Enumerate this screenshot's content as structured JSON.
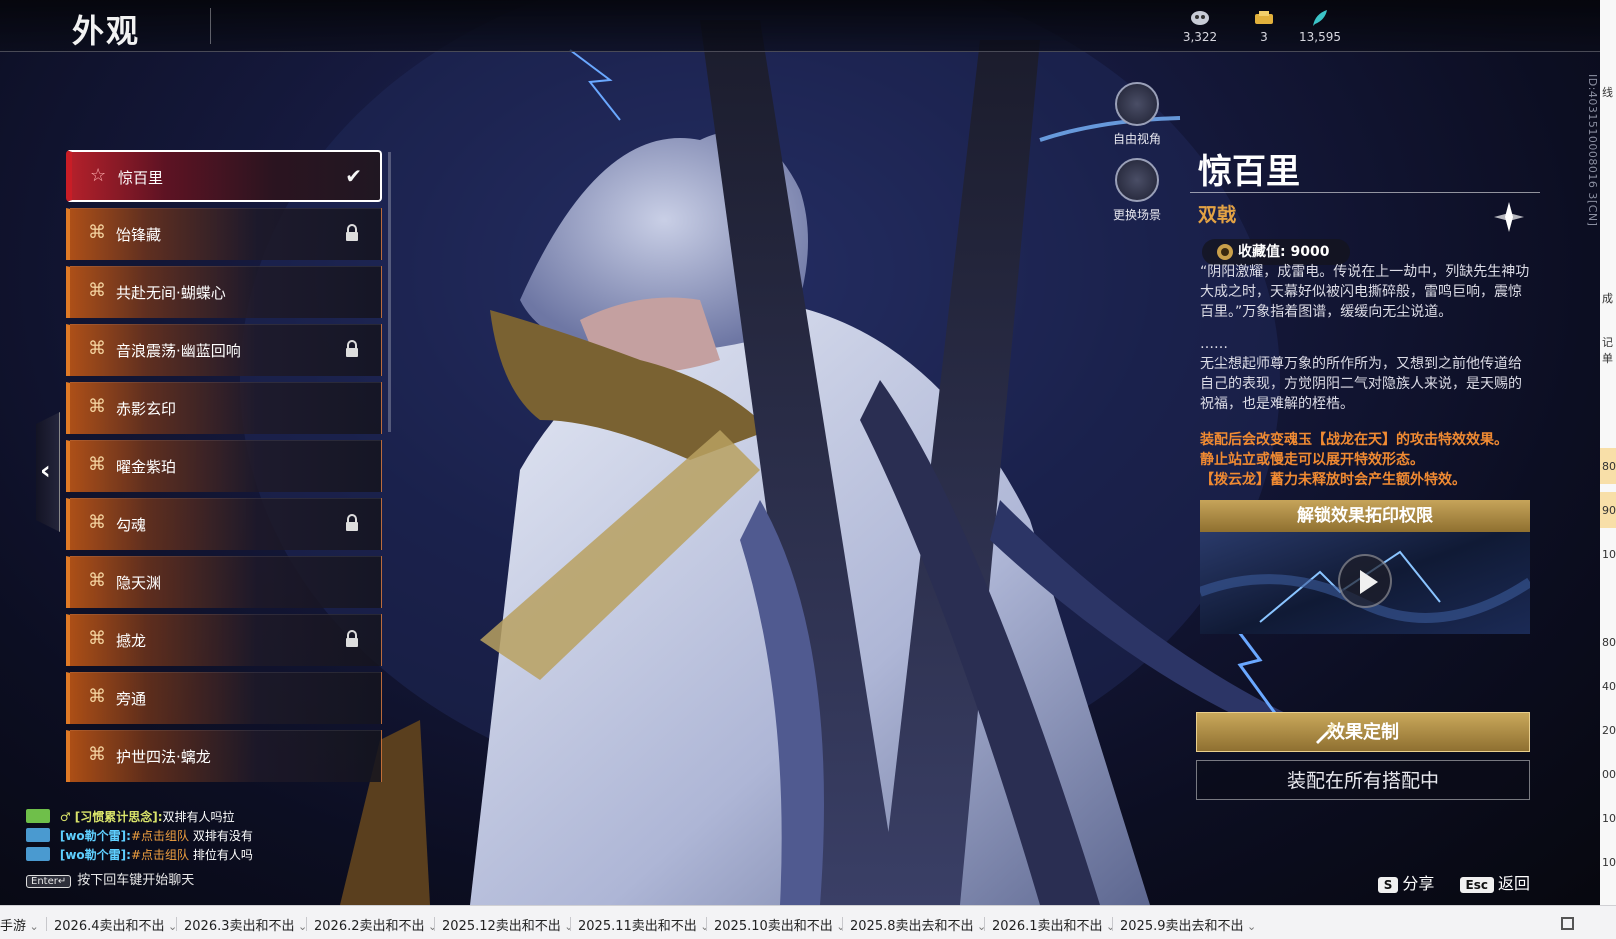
{
  "header": {
    "title": "外观",
    "currencies": [
      {
        "icon": "mask-currency-icon",
        "value": "3,322"
      },
      {
        "icon": "ticket-currency-icon",
        "value": "3"
      },
      {
        "icon": "feather-currency-icon",
        "value": "13,595"
      }
    ]
  },
  "list": {
    "items": [
      {
        "label": "惊百里",
        "state": "selected"
      },
      {
        "label": "饴锋藏",
        "state": "locked"
      },
      {
        "label": "共赴无间·蝴蝶心",
        "state": "none"
      },
      {
        "label": "音浪震荡·幽蓝回响",
        "state": "locked"
      },
      {
        "label": "赤影玄印",
        "state": "none"
      },
      {
        "label": "曜金紫珀",
        "state": "none"
      },
      {
        "label": "勾魂",
        "state": "locked"
      },
      {
        "label": "隐天渊",
        "state": "none"
      },
      {
        "label": "撼龙",
        "state": "locked"
      },
      {
        "label": "旁通",
        "state": "none"
      },
      {
        "label": "护世四法·螭龙",
        "state": "none"
      }
    ]
  },
  "camera": {
    "free_view_label": "自由视角",
    "change_scene_label": "更换场景"
  },
  "detail": {
    "name": "惊百里",
    "weapon_type": "双戟",
    "collect_label": "收藏值: 9000",
    "desc1": "“阴阳激耀，成雷电。传说在上一劫中，列缺先生神功大成之时，天幕好似被闪电撕碎般，雷鸣巨响，震惊百里。”万象指着图谱，缓缓向无尘说道。",
    "ellipsis": "……",
    "desc2": "无尘想起师尊万象的所作所为，又想到之前他传道给自己的表现，方觉阴阳二气对隐族人来说，是天赐的祝福，也是难解的桎梏。",
    "effect1": "装配后会改变魂玉【战龙在天】的攻击特效效果。",
    "effect2": "静止站立或慢走可以展开特效形态。",
    "effect3": "【拨云龙】蓄力未释放时会产生额外特效。",
    "unlock_label": "解锁效果拓印权限",
    "custom_button": "效果定制",
    "equip_button": "装配在所有搭配中",
    "side_id": "ID:4031510008016 3[CN]"
  },
  "chat": {
    "lines": [
      {
        "prefix": "♂ [习惯累计思念]:",
        "text": "双排有人吗拉"
      },
      {
        "prefix": "[wo勒个雷]:",
        "link": "#点击组队",
        "text": " 双排有没有"
      },
      {
        "prefix": "[wo勒个雷]:",
        "link": "#点击组队",
        "text": " 排位有人吗"
      }
    ],
    "enter_key": "Enter↵",
    "hint": "按下回车键开始聊天"
  },
  "shortcuts": {
    "share_key": "S",
    "share_label": "分享",
    "back_key": "Esc",
    "back_label": "返回"
  },
  "tabs": [
    "手游",
    "2026.4卖出和不出",
    "2026.3卖出和不出",
    "2026.2卖出和不出",
    "2025.12卖出和不出",
    "2025.11卖出和不出",
    "2025.10卖出和不出",
    "2025.8卖出去和不出",
    "2026.1卖出和不出",
    "2025.9卖出去和不出"
  ],
  "edge_cells": [
    "线",
    "成",
    "记单",
    "80",
    "90",
    "10",
    "80",
    "40",
    "20",
    "00",
    "10",
    "10"
  ],
  "colors": {
    "accent_orange": "#e07a26",
    "selected_red": "#c81d26",
    "gold": "#c6a45a",
    "weapon_type": "#e3a244"
  }
}
